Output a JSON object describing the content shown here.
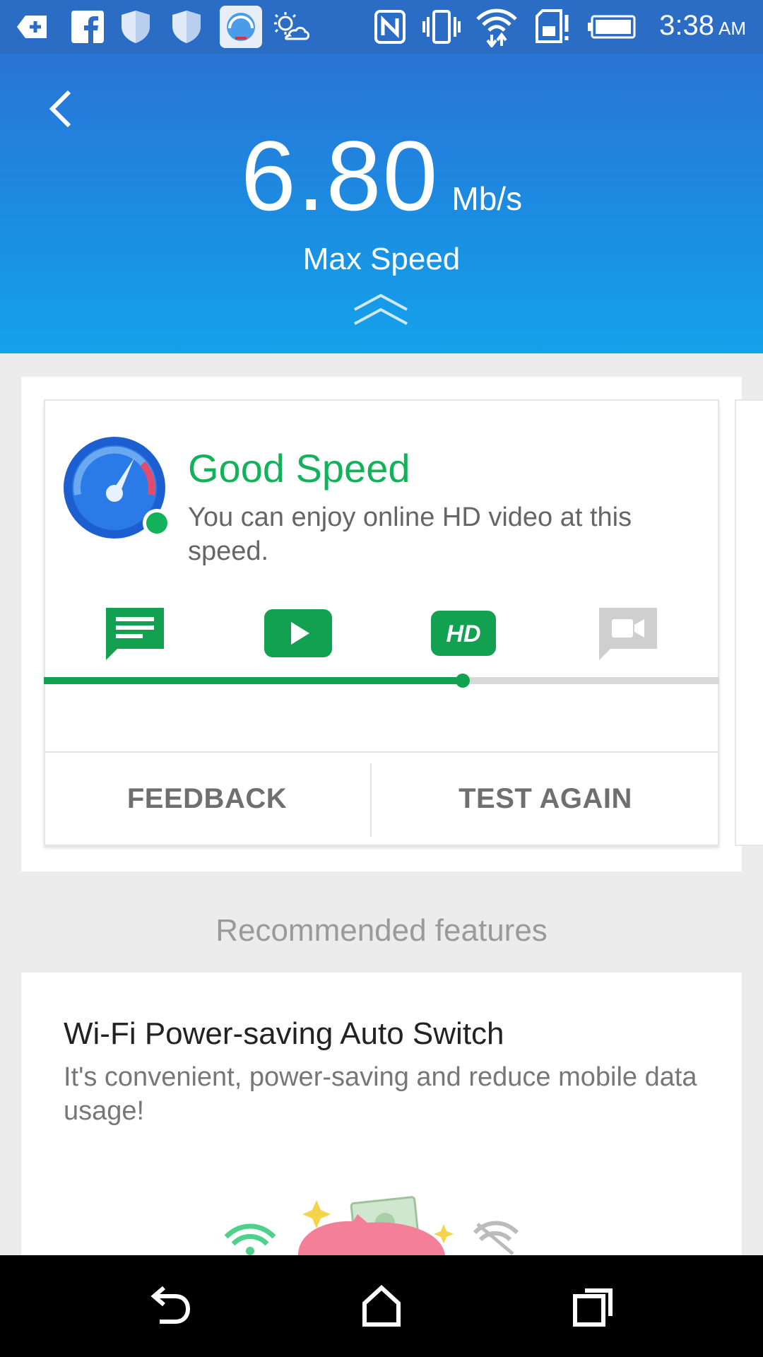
{
  "status_bar": {
    "time": "3:38",
    "ampm": "AM",
    "icons": [
      "add-box-icon",
      "facebook-icon",
      "shield-icon",
      "shield-icon",
      "speed-app-icon",
      "weather-icon",
      "nfc-icon",
      "vibrate-icon",
      "wifi-icon",
      "sd-card-alert-icon",
      "battery-icon"
    ]
  },
  "header": {
    "speed_value": "6.80",
    "speed_unit": "Mb/s",
    "speed_label": "Max Speed",
    "bg_colors": [
      "#2a74d6",
      "#14a2ea"
    ]
  },
  "result": {
    "title": "Good Speed",
    "description": "You can enjoy online HD video at this speed.",
    "activities": [
      {
        "icon": "chat-icon",
        "active": true
      },
      {
        "icon": "play-video-icon",
        "active": true
      },
      {
        "icon": "hd-icon",
        "active": true
      },
      {
        "icon": "video-call-icon",
        "active": false
      }
    ],
    "progress_fraction": 0.62,
    "accent_color": "#12a150"
  },
  "buttons": {
    "feedback": "FEEDBACK",
    "test_again": "TEST AGAIN"
  },
  "recommended": {
    "section_title": "Recommended features",
    "feature_title": "Wi-Fi Power-saving Auto Switch",
    "feature_desc": "It's convenient, power-saving and reduce mobile data usage!"
  },
  "nav": {
    "icons": [
      "back-nav-icon",
      "home-nav-icon",
      "recents-nav-icon"
    ]
  }
}
